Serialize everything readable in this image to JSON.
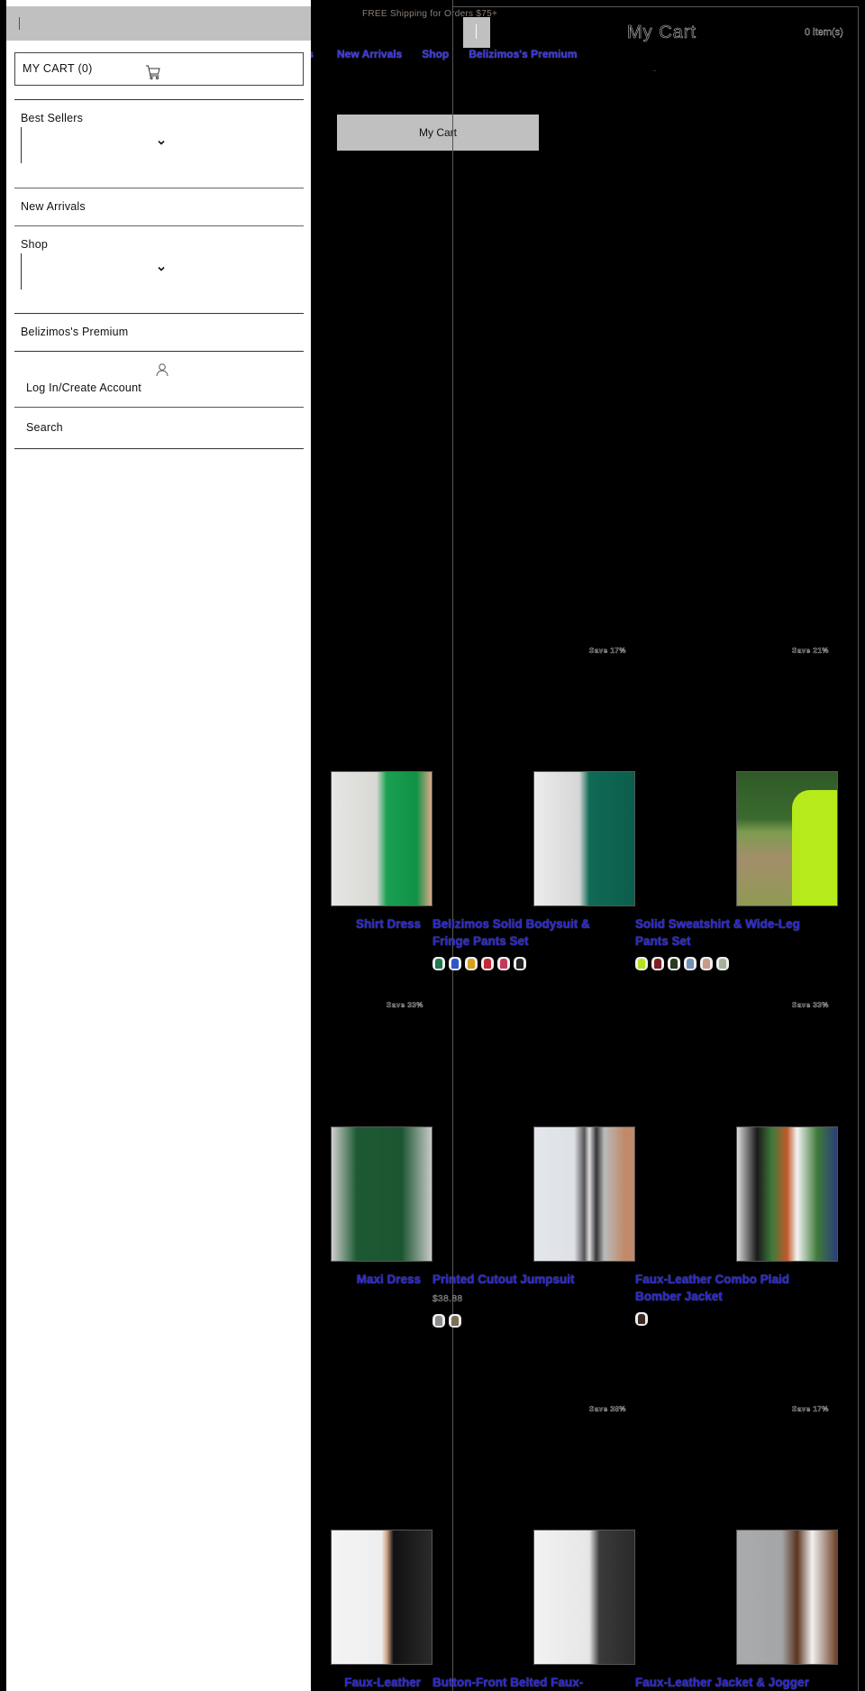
{
  "announcement": "FREE Shipping for Orders $75+",
  "nav": {
    "items": [
      "Best Sellers",
      "New Arrivals",
      "Shop",
      "Belizimos's Premium"
    ]
  },
  "page": {
    "my_cart_button": "My Cart"
  },
  "cart_panel": {
    "title": "My Cart",
    "count": "0 item(s)",
    "dots": ".."
  },
  "drawer": {
    "cart_label": "MY CART (0)",
    "menu": [
      {
        "label": "Best Sellers",
        "has_dropdown": true
      },
      {
        "label": "New Arrivals",
        "has_dropdown": false
      },
      {
        "label": "Shop",
        "has_dropdown": true
      },
      {
        "label": "Belizimos's Premium",
        "has_dropdown": false
      }
    ],
    "account_label": "Log In/Create Account",
    "search_label": "Search"
  },
  "products": [
    {
      "title": "Shirt Dress",
      "badge": "",
      "price": "",
      "swatches": []
    },
    {
      "title": "Belizimos Solid Bodysuit & Fringe Pants Set",
      "badge": "Save 17%",
      "price": "",
      "swatches": [
        "#1f7a4f",
        "#2d57c8",
        "#d1a21d",
        "#c0283a",
        "#c23b5f",
        "#222222"
      ]
    },
    {
      "title": "Solid Sweatshirt & Wide-Leg Pants Set",
      "badge": "Save 21%",
      "price": "",
      "swatches": [
        "#b4e21f",
        "#7a1f25",
        "#2b3a22",
        "#6f8fb8",
        "#c99a8a",
        "#a7b09a"
      ]
    },
    {
      "title": "Maxi Dress",
      "badge": "Save 33%",
      "price": "",
      "swatches": []
    },
    {
      "title": "Printed Cutout Jumpsuit",
      "badge": "",
      "price": "$38.88",
      "swatches": [
        "#8c8c8c",
        "#7a6f55"
      ]
    },
    {
      "title": "Faux-Leather Combo Plaid Bomber Jacket",
      "badge": "Save 33%",
      "price": "",
      "swatches": [
        "#3a2a22"
      ]
    },
    {
      "title": "Faux-Leather",
      "badge": "",
      "price": "",
      "swatches": []
    },
    {
      "title": "Button-Front Belted Faux-",
      "badge": "Save 38%",
      "price": "",
      "swatches": []
    },
    {
      "title": "Faux-Leather Jacket & Jogger",
      "badge": "Save 17%",
      "price": "",
      "swatches": []
    }
  ],
  "colors": {
    "link_blue": "#2a27c9",
    "drawer_bg": "#ffffff",
    "button_gray": "#c0c0c0"
  }
}
